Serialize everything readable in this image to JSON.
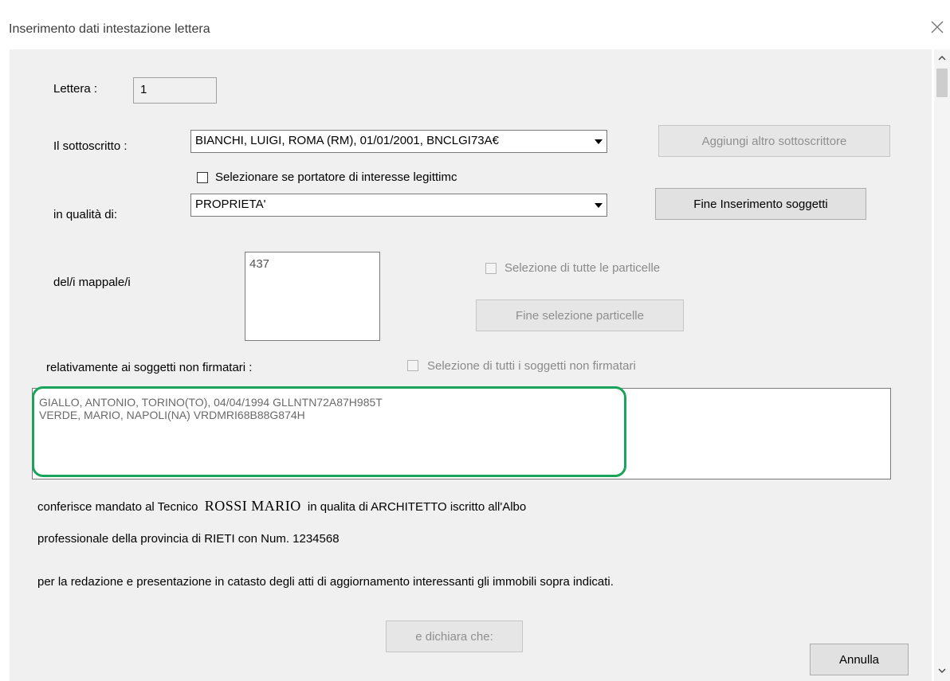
{
  "window": {
    "title": "Inserimento dati intestazione lettera"
  },
  "lettera": {
    "label": "Lettera :",
    "value": "1"
  },
  "sottoscritto": {
    "label": "Il sottoscritto :",
    "value": "BIANCHI, LUIGI, ROMA (RM), 01/01/2001, BNCLGI73A€",
    "add_button": "Aggiungi altro sottoscrittore"
  },
  "interesse": {
    "label": "Selezionare se portatore di interesse legittimc"
  },
  "qualita": {
    "label": "in qualità di:",
    "value": "PROPRIETA'",
    "end_button": "Fine Inserimento soggetti"
  },
  "mappali": {
    "label": "del/i mappale/i",
    "value": "437",
    "select_all_label": "Selezione di tutte le particelle",
    "end_button": "Fine selezione particelle"
  },
  "non_firmatari": {
    "label": "relativamente ai soggetti non firmatari :",
    "select_all_label": "Selezione di tutti i soggetti non firmatari",
    "lines": [
      "GIALLO, ANTONIO, TORINO(TO), 04/04/1994 GLLNTN72A87H985T",
      "VERDE, MARIO, NAPOLI(NA) VRDMRI68B88G874H"
    ]
  },
  "mandato": {
    "prefix": "conferisce mandato al Tecnico",
    "tecnico": "ROSSI MARIO",
    "suffix": "in qualita di ARCHITETTO iscritto all'Albo",
    "line2": "professionale della provincia di RIETI con Num. 1234568",
    "line3": "per la redazione e presentazione in catasto degli atti di aggiornamento interessanti gli immobili sopra indicati."
  },
  "buttons": {
    "dichiara": "e dichiara che:",
    "annulla": "Annulla"
  },
  "colors": {
    "highlight": "#1aa35b",
    "dialog_bg": "#f0f0f0"
  }
}
